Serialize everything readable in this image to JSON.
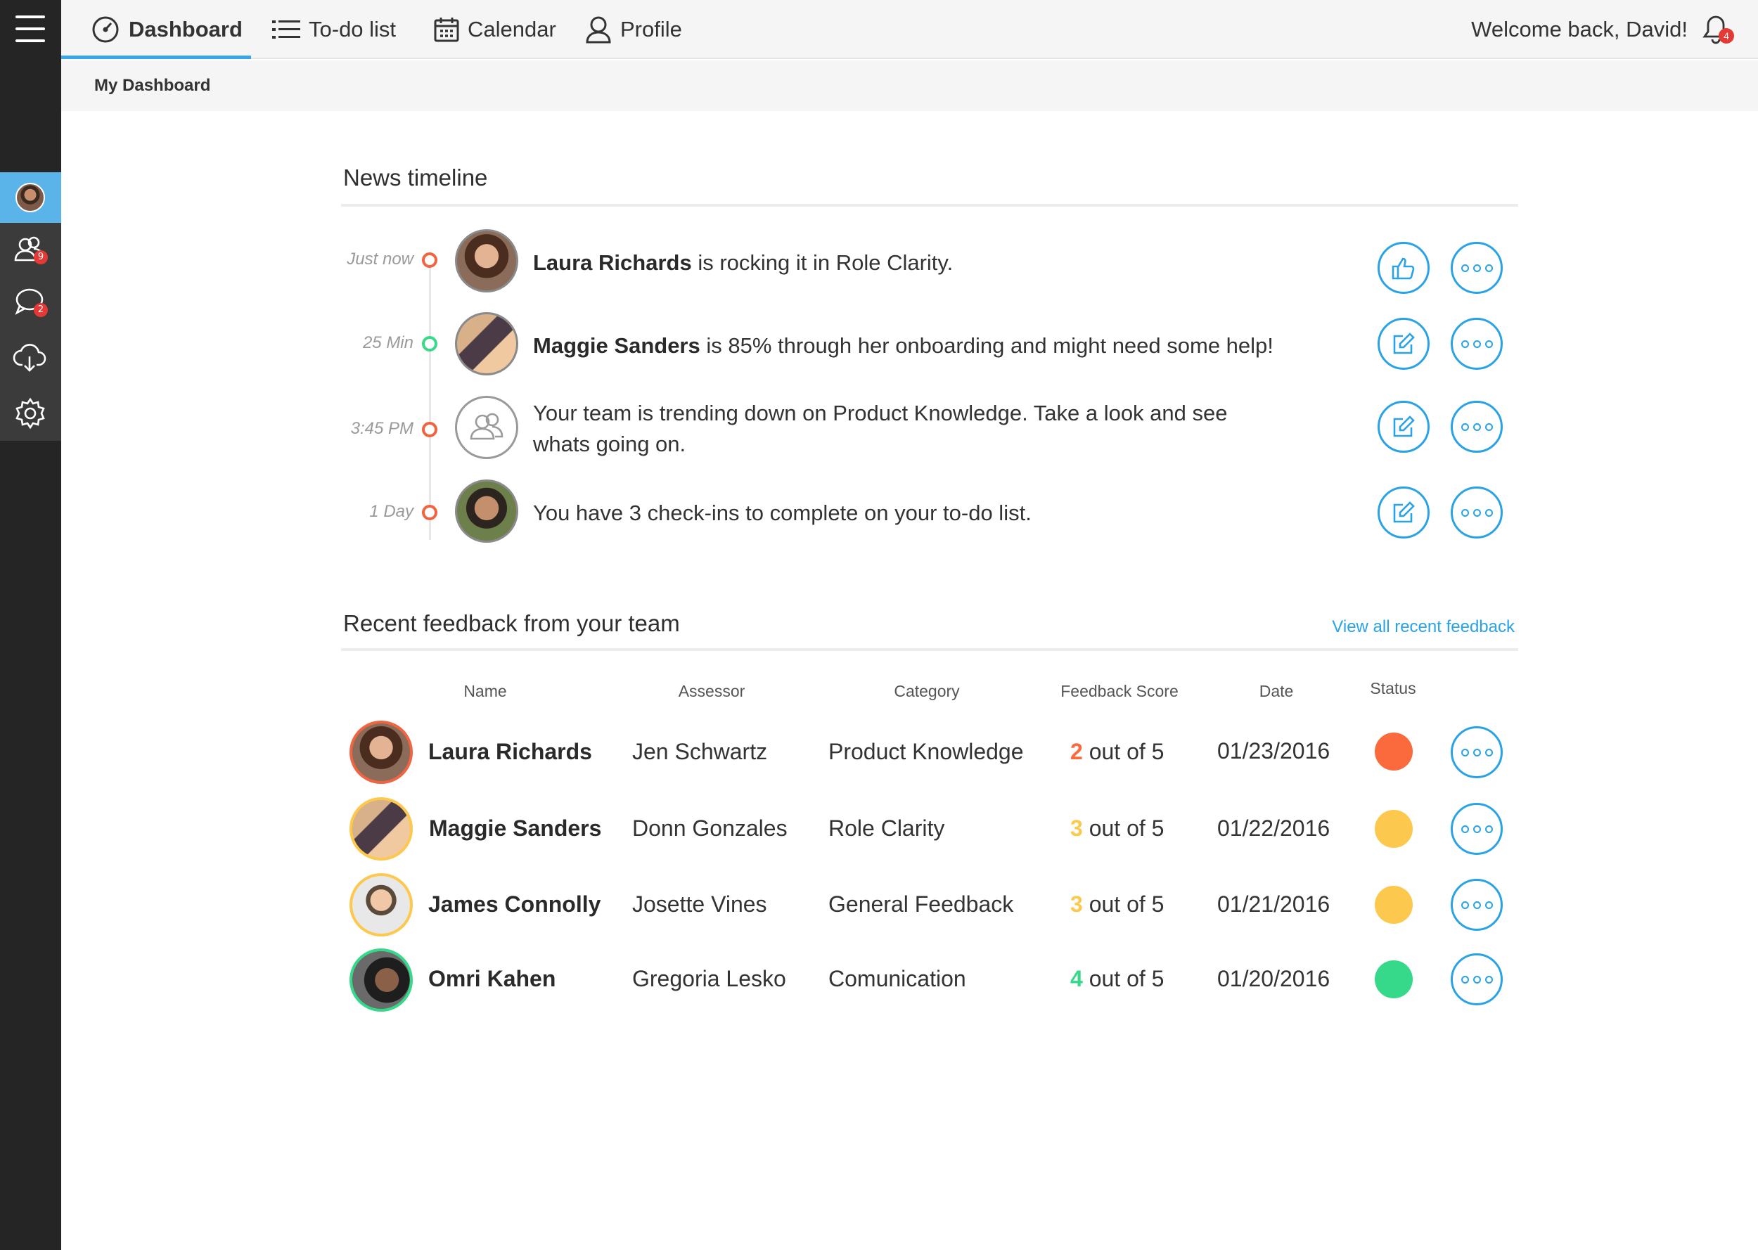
{
  "nav": {
    "items": [
      {
        "label": "Dashboard",
        "icon": "speedometer-icon"
      },
      {
        "label": "To-do list",
        "icon": "list-icon"
      },
      {
        "label": "Calendar",
        "icon": "calendar-icon"
      },
      {
        "label": "Profile",
        "icon": "user-icon"
      }
    ],
    "welcome": "Welcome back, David!",
    "notification_count": "4"
  },
  "sidebar": {
    "team_badge": "9",
    "chat_badge": "2"
  },
  "breadcrumb": "My Dashboard",
  "timeline": {
    "title": "News timeline",
    "items": [
      {
        "time": "Just now",
        "name": "Laura Richards",
        "text": " is rocking it in Role Clarity.",
        "action": "thumbs-up-icon",
        "dot": "#f06442"
      },
      {
        "time": "25 Min",
        "name": "Maggie Sanders",
        "text": " is 85% through her onboarding and might need some help!",
        "action": "edit-icon",
        "dot": "#39d98a"
      },
      {
        "time": "3:45 PM",
        "name": "",
        "text": "Your team is trending down on Product Knowledge. Take a look and see whats going on.",
        "action": "edit-icon",
        "dot": "#f06442"
      },
      {
        "time": "1 Day",
        "name": "",
        "text": "You have 3 check-ins to complete on your to-do list.",
        "action": "edit-icon",
        "dot": "#f06442"
      }
    ]
  },
  "feedback": {
    "title": "Recent feedback from your team",
    "view_all": "View all recent feedback",
    "columns": [
      "Name",
      "Assessor",
      "Category",
      "Feedback Score",
      "Date",
      "Status"
    ],
    "score_suffix": "out of 5",
    "rows": [
      {
        "name": "Laura Richards",
        "assessor": "Jen Schwartz",
        "category": "Product Knowledge",
        "score": "2",
        "date": "01/23/2016",
        "color": "#fb6a3d"
      },
      {
        "name": "Maggie Sanders",
        "assessor": "Donn Gonzales",
        "category": "Role Clarity",
        "score": "3",
        "date": "01/22/2016",
        "color": "#fcc94e"
      },
      {
        "name": "James Connolly",
        "assessor": "Josette Vines",
        "category": "General Feedback",
        "score": "3",
        "date": "01/21/2016",
        "color": "#fcc94e"
      },
      {
        "name": "Omri Kahen",
        "assessor": "Gregoria Lesko",
        "category": "Comunication",
        "score": "4",
        "date": "01/20/2016",
        "color": "#36d98a"
      }
    ]
  },
  "colors": {
    "accent": "#2aa2e6",
    "sidebar": "#252525"
  }
}
